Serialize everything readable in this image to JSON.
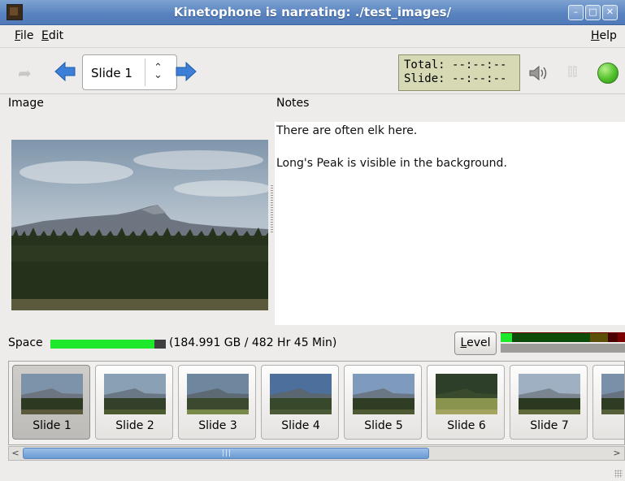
{
  "window": {
    "title": "Kinetophone is narrating: ./test_images/",
    "controls": [
      "minimize",
      "maximize",
      "close"
    ]
  },
  "menubar": {
    "file": {
      "mnemonic": "F",
      "rest": "ile"
    },
    "edit": {
      "mnemonic": "E",
      "rest": "dit"
    },
    "help": {
      "mnemonic": "H",
      "rest": "elp"
    }
  },
  "toolbar": {
    "current_slide": "Slide 1",
    "timer": {
      "total_label": "Total:",
      "total_value": "--:--:--",
      "slide_label": "Slide:",
      "slide_value": "--:--:--"
    },
    "icons": [
      "forward-disabled-icon",
      "previous-arrow-icon",
      "next-arrow-icon",
      "speaker-icon",
      "pause-icon",
      "record-indicator"
    ]
  },
  "panes": {
    "image_header": "Image",
    "notes_header": "Notes",
    "notes": [
      "There are often elk here.",
      "Long's Peak is visible in the background."
    ]
  },
  "space": {
    "label": "Space",
    "detail": "(184.991 GB / 482 Hr 45 Min)",
    "used_fraction": 0.9
  },
  "level": {
    "button_mnemonic": "L",
    "button_rest": "evel"
  },
  "thumbnails": [
    {
      "label": "Slide 1",
      "selected": true
    },
    {
      "label": "Slide 2",
      "selected": false
    },
    {
      "label": "Slide 3",
      "selected": false
    },
    {
      "label": "Slide 4",
      "selected": false
    },
    {
      "label": "Slide 5",
      "selected": false
    },
    {
      "label": "Slide 6",
      "selected": false
    },
    {
      "label": "Slide 7",
      "selected": false
    },
    {
      "label": "Sli",
      "selected": false
    }
  ],
  "colors": {
    "titlebar": "#5a84c0",
    "space_fill": "#1ee82b",
    "timer_bg": "#d7d9b5",
    "accent_arrow": "#3b7fd6"
  }
}
